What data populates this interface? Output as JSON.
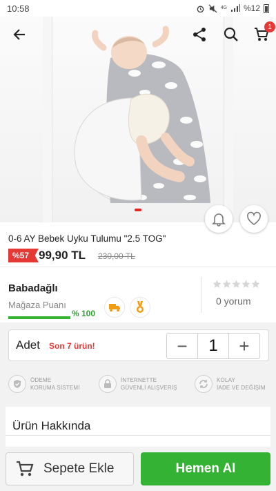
{
  "status_bar": {
    "time": "10:58",
    "network_top": "4G",
    "network_bottom": "",
    "battery_text": "%12"
  },
  "header": {
    "icons": [
      "back-arrow-icon",
      "share-icon",
      "search-icon",
      "cart-icon"
    ],
    "cart_count": "1"
  },
  "product": {
    "title": "0-6 AY Bebek Uyku Tulumu \"2.5 TOG\"",
    "discount_badge": "%57",
    "price": "99,90 TL",
    "old_price": "230,00 TL"
  },
  "seller": {
    "name": "Babadağlı",
    "store_score_label": "Mağaza Puanı",
    "store_score_value": "% 100",
    "review_count": "0 yorum",
    "rating": 0
  },
  "quantity": {
    "label": "Adet",
    "stock_note": "Son 7 ürün!",
    "value": "1",
    "minus": "−",
    "plus": "+"
  },
  "guarantees": [
    {
      "line1": "ÖDEME",
      "line2": "KORUMA SİSTEMİ"
    },
    {
      "line1": "İNTERNETTE",
      "line2": "GÜVENLİ ALIŞVERİŞ"
    },
    {
      "line1": "KOLAY",
      "line2": "İADE VE DEĞİŞİM"
    }
  ],
  "about": {
    "title": "Ürün Hakkında"
  },
  "actions": {
    "add_to_cart": "Sepete Ekle",
    "buy_now": "Hemen Al"
  },
  "colors": {
    "accent_red": "#e53935",
    "accent_green": "#33b233"
  }
}
